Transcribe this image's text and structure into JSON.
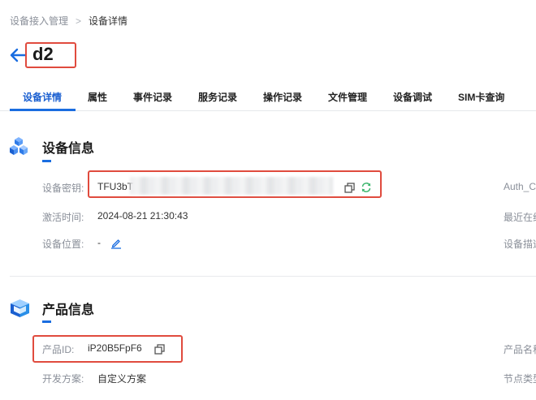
{
  "breadcrumb": {
    "parent": "设备接入管理",
    "separator": ">",
    "current": "设备详情"
  },
  "header": {
    "title": "d2"
  },
  "tabs": [
    {
      "label": "设备详情",
      "active": true
    },
    {
      "label": "属性"
    },
    {
      "label": "事件记录"
    },
    {
      "label": "服务记录"
    },
    {
      "label": "操作记录"
    },
    {
      "label": "文件管理"
    },
    {
      "label": "设备调试"
    },
    {
      "label": "SIM卡查询"
    }
  ],
  "device_info": {
    "title": "设备信息",
    "secret_label": "设备密钥:",
    "secret_value": "TFU3bT",
    "activated_label": "激活时间:",
    "activated_value": "2024-08-21 21:30:43",
    "location_label": "设备位置:",
    "location_value": "-",
    "right_labels": [
      "Auth_C",
      "最近在线",
      "设备描述"
    ]
  },
  "product_info": {
    "title": "产品信息",
    "product_id_label": "产品ID:",
    "product_id_value": "iP20B5FpF6",
    "dev_plan_label": "开发方案:",
    "dev_plan_value": "自定义方案",
    "right_labels": [
      "产品名称",
      "节点类型"
    ]
  },
  "colors": {
    "accent": "#1a6de0",
    "highlight_box": "#e04b3e",
    "refresh_icon": "#3bb56c"
  },
  "icons": [
    "back-arrow-icon",
    "device-cube-icon",
    "copy-icon",
    "refresh-icon",
    "edit-icon",
    "product-box-icon"
  ]
}
